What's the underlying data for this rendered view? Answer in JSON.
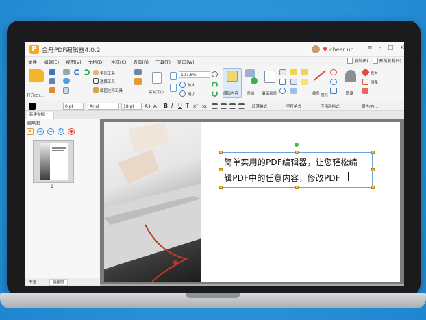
{
  "app": {
    "title": "金舟PDF编辑器4.0.2",
    "logo_letter": "P",
    "user_name": "cheer up",
    "window_controls": [
      "≡",
      "–",
      "□",
      "✕"
    ]
  },
  "menu": {
    "items": [
      "文件",
      "编辑(E)",
      "视图(V)",
      "文档(D)",
      "注释(C)",
      "表单(R)",
      "工具(T)",
      "窗口(W)"
    ],
    "right_items": [
      "复制(P)",
      "预览复制(S)"
    ]
  },
  "ribbon": {
    "open_label": "打开(O)...",
    "hand_label": "手形工具",
    "select_label": "选择工具",
    "snapshot_label": "截图注释工具",
    "actual_size_label": "实际大小",
    "zoom_value": "107.6%",
    "zoom_in_label": "放大",
    "zoom_out_label": "缩小",
    "edit_content_label": "编辑内容",
    "add_label": "添加",
    "edit_form_label": "编辑表单",
    "link_label": "线条",
    "stamp_label": "图章",
    "sign_label": "签名",
    "measure_label": "测量",
    "note_label": "图形"
  },
  "format": {
    "color": "#000000",
    "line_width": "0 pt",
    "font_name": "Arial",
    "font_size": "18 pt",
    "increase_font": "A+",
    "decrease_font": "A-",
    "bold": "B",
    "italic": "I",
    "underline": "U",
    "strike": "T",
    "superscript": "x²",
    "subscript": "x₂",
    "para_style_label": "段落格式",
    "char_style_label": "字符格式",
    "apply_style_label": "应用新格式",
    "attributes_label": "属性(P)..."
  },
  "tabs": {
    "document_tab": "新建文档 *"
  },
  "left_panel": {
    "title": "缩略图",
    "page_number": "1",
    "bottom_tabs": [
      "书签",
      "缩略图"
    ]
  },
  "document": {
    "line1": "简单实用的PDF编辑器，让您轻松编",
    "line2": "辑PDF中的任意内容，修改PDF"
  },
  "colors": {
    "background": "#2f9ce0",
    "accent": "#f5a623",
    "selection": "#6ea1d8"
  }
}
